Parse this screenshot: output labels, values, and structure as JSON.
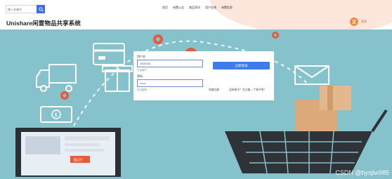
{
  "header": {
    "search": {
      "placeholder": "输入关键词"
    },
    "brand": "Unishare闲置物品共享系统",
    "nav": [
      "首页",
      "闲置公告",
      "商品资讯",
      "用户反馈",
      "闲置信息"
    ],
    "user": {
      "label": "登录"
    }
  },
  "banner": {
    "laptop_screen_text": "BUY"
  },
  "login": {
    "username_label": "用户名",
    "username_value": "2001044",
    "username_hint": "忘记用户",
    "password_label": "密码",
    "password_value": "••••••",
    "password_hint": "忘记密码",
    "login_button": "立即登录",
    "register_link": "快速注册",
    "no_account_link": "没有账号？先注册—个账户吧！"
  },
  "watermark": "CSDN @bysjlw985",
  "colors": {
    "accent": "#3f7bea",
    "brand_orange": "#f08a3c",
    "banner_bg": "#86c2cc"
  }
}
